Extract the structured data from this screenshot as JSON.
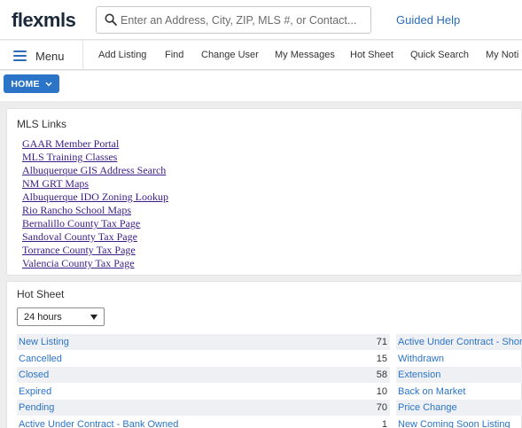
{
  "header": {
    "logo": "flexmls",
    "search_placeholder": "Enter an Address, City, ZIP, MLS #, or Contact...",
    "guided_help": "Guided Help"
  },
  "menubar": {
    "menu_label": "Menu",
    "items": [
      "Add Listing",
      "Find",
      "Change User",
      "My Messages",
      "Hot Sheet",
      "Quick Search",
      "My Noti"
    ]
  },
  "home_button": {
    "label": "HOME"
  },
  "mls_links": {
    "title": "MLS Links",
    "links": [
      "GAAR Member Portal",
      "MLS Training Classes",
      "Albuquerque GIS Address Search",
      "NM GRT Maps",
      "Albuquerque IDO Zoning Lookup",
      "Rio Rancho School Maps",
      "Bernalillo County Tax Page",
      "Sandoval County Tax Page",
      "Torrance County Tax Page",
      "Valencia County Tax Page"
    ]
  },
  "hot_sheet": {
    "title": "Hot Sheet",
    "period_selected": "24 hours",
    "left": [
      {
        "label": "New Listing",
        "count": "71"
      },
      {
        "label": "Cancelled",
        "count": "15"
      },
      {
        "label": "Closed",
        "count": "58"
      },
      {
        "label": "Expired",
        "count": "10"
      },
      {
        "label": "Pending",
        "count": "70"
      },
      {
        "label": "Active Under Contract - Bank Owned",
        "count": "1"
      }
    ],
    "right": [
      {
        "label": "Active Under Contract - Shor"
      },
      {
        "label": "Withdrawn"
      },
      {
        "label": "Extension"
      },
      {
        "label": "Back on Market"
      },
      {
        "label": "Price Change"
      },
      {
        "label": "New Coming Soon Listing"
      }
    ]
  },
  "colors": {
    "accent": "#2b74c7",
    "link_visited": "#3a1c86",
    "logo": "#1b2a3a",
    "row_shade": "#eef0f3"
  }
}
